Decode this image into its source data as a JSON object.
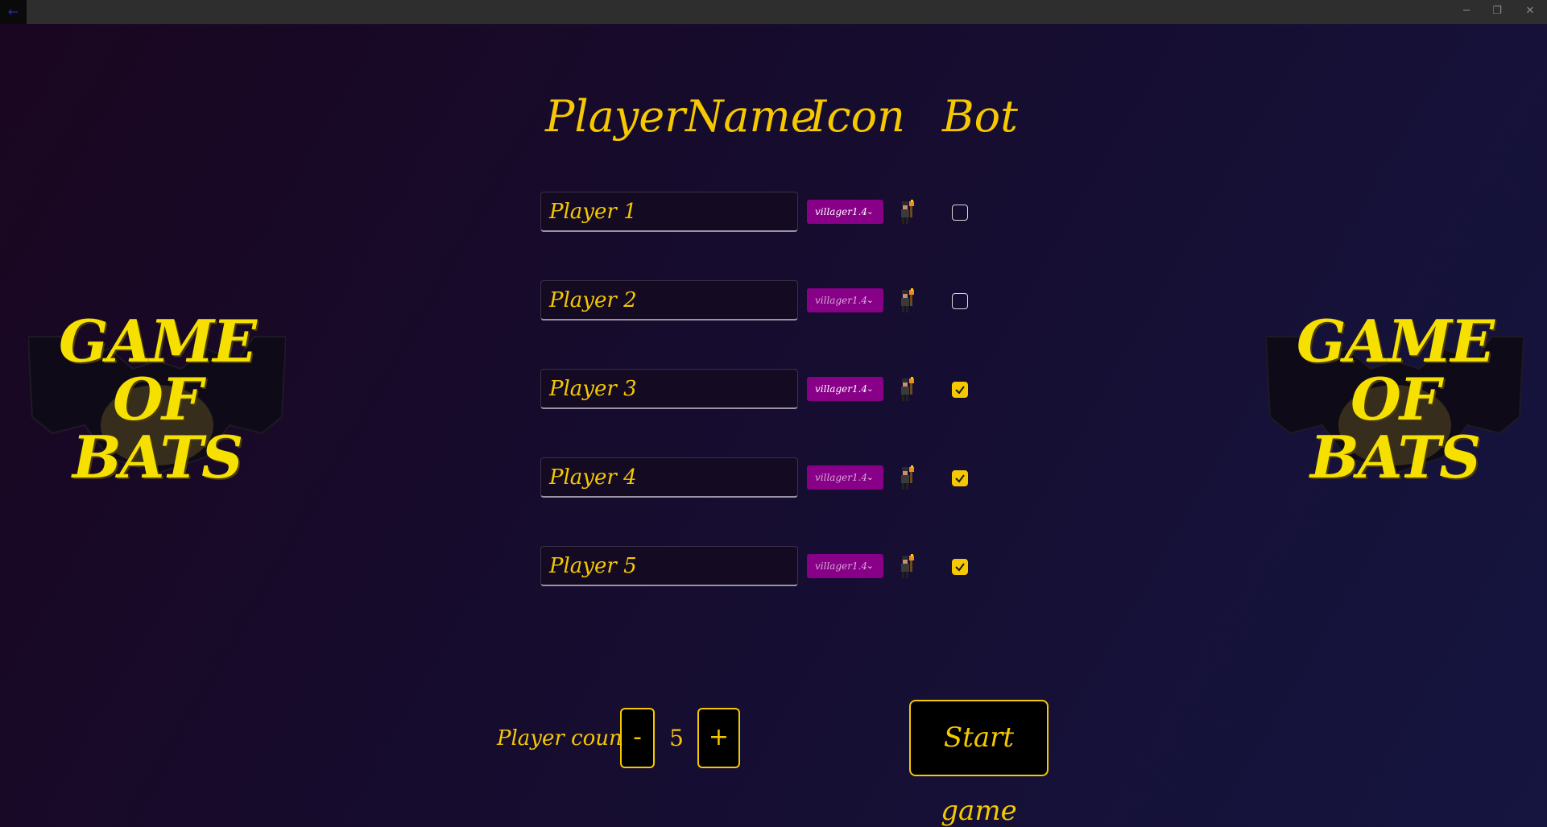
{
  "window": {
    "back_glyph": "←",
    "minimize_glyph": "─",
    "maximize_glyph": "❐",
    "close_glyph": "✕"
  },
  "logo": {
    "lines": [
      "GAME",
      "OF",
      "BATS"
    ]
  },
  "headers": {
    "name": "PlayerName",
    "icon": "Icon",
    "bot": "Bot"
  },
  "players": [
    {
      "name": "Player 1",
      "icon": "villager1.4",
      "bot": false
    },
    {
      "name": "Player 2",
      "icon": "villager1.4",
      "bot": false
    },
    {
      "name": "Player 3",
      "icon": "villager1.4",
      "bot": true
    },
    {
      "name": "Player 4",
      "icon": "villager1.4",
      "bot": true
    },
    {
      "name": "Player 5",
      "icon": "villager1.4",
      "bot": true
    }
  ],
  "controls": {
    "count_label": "Player count:",
    "minus_label": "-",
    "count_value": "5",
    "plus_label": "+",
    "start_label": "Start game"
  },
  "colors": {
    "accent": "#f5c800",
    "select_bg": "#870087"
  },
  "icons": {
    "dropdown": "chevron-down-icon",
    "sprite": "villager-sprite-icon",
    "check": "checkmark-icon"
  }
}
